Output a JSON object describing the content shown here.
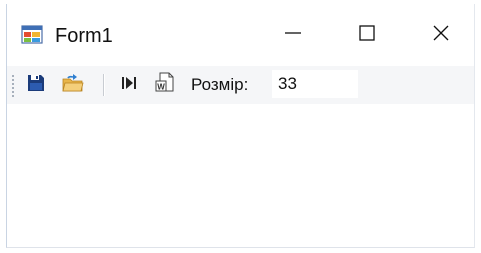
{
  "window": {
    "title": "Form1",
    "icon": "windows-form-icon"
  },
  "title_buttons": {
    "minimize_glyph": "—",
    "maximize_icon": "maximize-icon",
    "close_icon": "close-icon"
  },
  "toolbar": {
    "buttons": [
      {
        "icon": "save-icon"
      },
      {
        "icon": "open-folder-icon"
      },
      {
        "icon": "next-track-icon"
      },
      {
        "icon": "word-document-icon"
      }
    ],
    "size_label": "Розмір:",
    "size_value": "33"
  },
  "colors": {
    "toolbar_background": "#f5f6f8",
    "save_icon": "#1b3b7a",
    "folder_icon": "#e8b54a",
    "border": "#c9d4e3"
  }
}
